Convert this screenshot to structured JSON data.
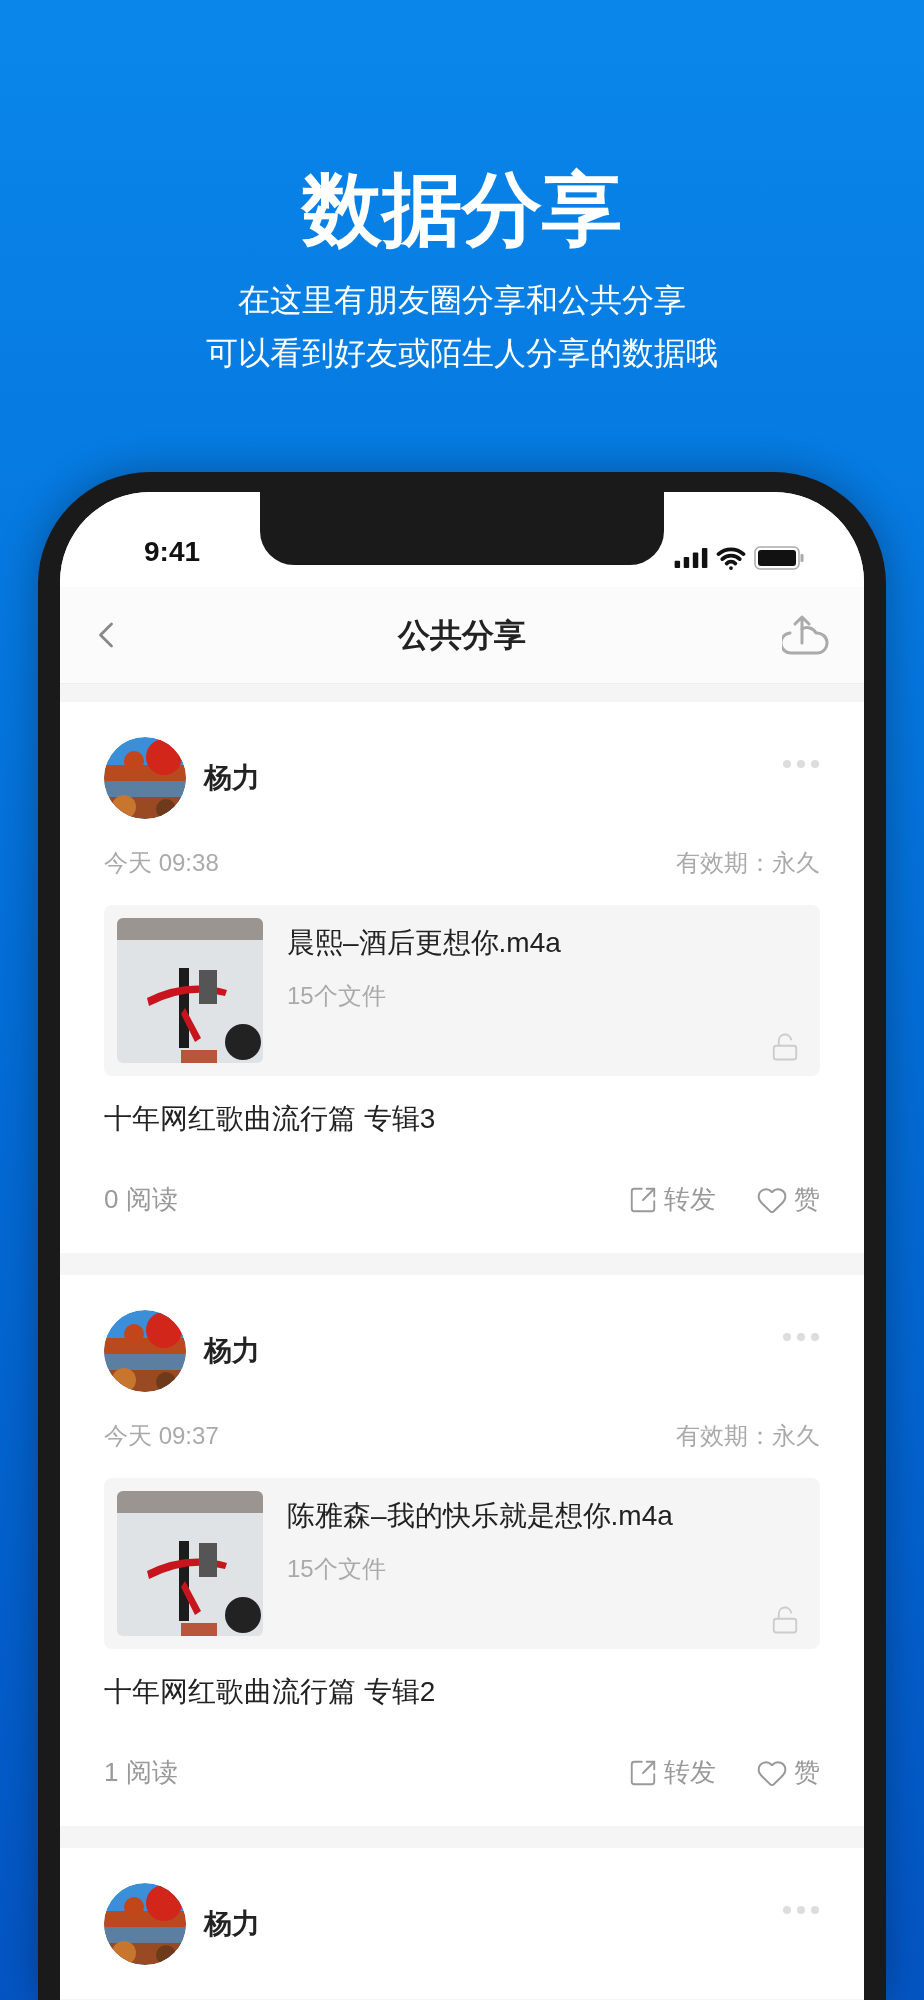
{
  "headline": "数据分享",
  "subtitle": [
    "在这里有朋友圈分享和公共分享",
    "可以看到好友或陌生人分享的数据哦"
  ],
  "status_bar": {
    "time": "9:41"
  },
  "nav": {
    "title": "公共分享"
  },
  "posts": [
    {
      "author": "杨力",
      "time": "今天 09:38",
      "validity": "有效期：永久",
      "file_name": "晨熙–酒后更想你.m4a",
      "file_count": "15个文件",
      "title": "十年网红歌曲流行篇 专辑3",
      "reads": "0 阅读",
      "forward": "转发",
      "like": "赞"
    },
    {
      "author": "杨力",
      "time": "今天 09:37",
      "validity": "有效期：永久",
      "file_name": "陈雅森–我的快乐就是想你.m4a",
      "file_count": "15个文件",
      "title": "十年网红歌曲流行篇 专辑2",
      "reads": "1 阅读",
      "forward": "转发",
      "like": "赞"
    },
    {
      "author": "杨力"
    }
  ]
}
